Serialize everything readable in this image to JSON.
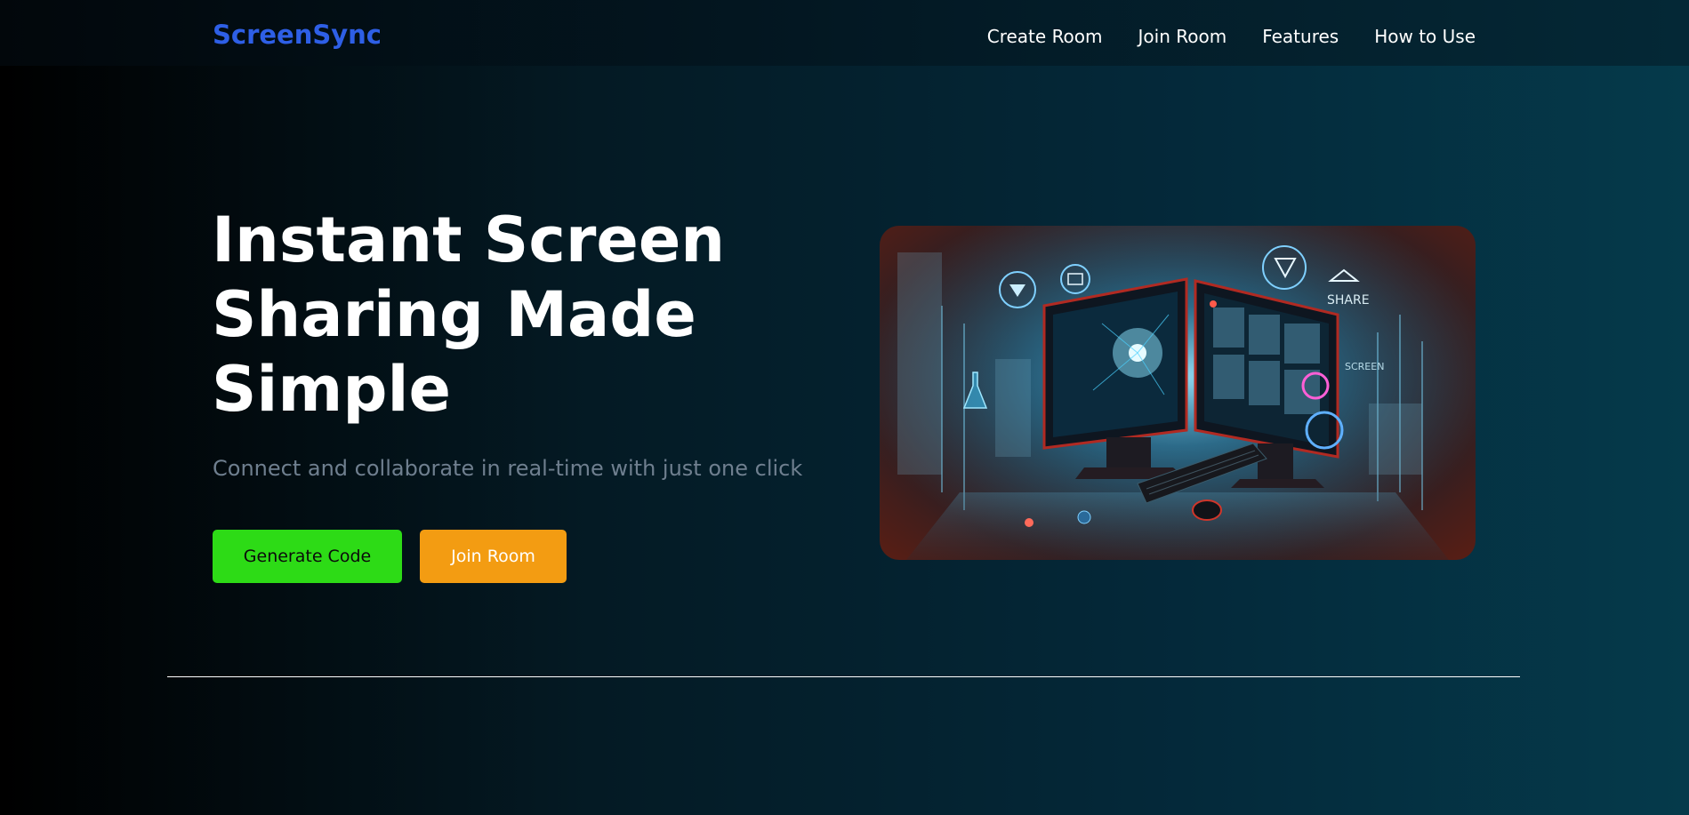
{
  "brand": {
    "name": "ScreenSync"
  },
  "nav": {
    "items": [
      {
        "label": "Create Room"
      },
      {
        "label": "Join Room"
      },
      {
        "label": "Features"
      },
      {
        "label": "How to Use"
      }
    ]
  },
  "hero": {
    "title_line1": "Instant Screen",
    "title_line2": "Sharing Made",
    "title_line3": "Simple",
    "subtitle": "Connect and collaborate in real-time with just one click",
    "generate_label": "Generate Code",
    "join_label": "Join Room",
    "image_share_text": "SHARE",
    "image_screen_text": "SCREEN"
  },
  "colors": {
    "brand": "#2e5fe6",
    "generate_button": "#2ddb16",
    "join_button": "#f39c12",
    "subtitle": "#6f7f8f"
  },
  "icons": [
    "play-icon",
    "mail-icon",
    "share-icon",
    "flask-icon",
    "monitor-icon",
    "keyboard-icon",
    "mouse-icon"
  ]
}
